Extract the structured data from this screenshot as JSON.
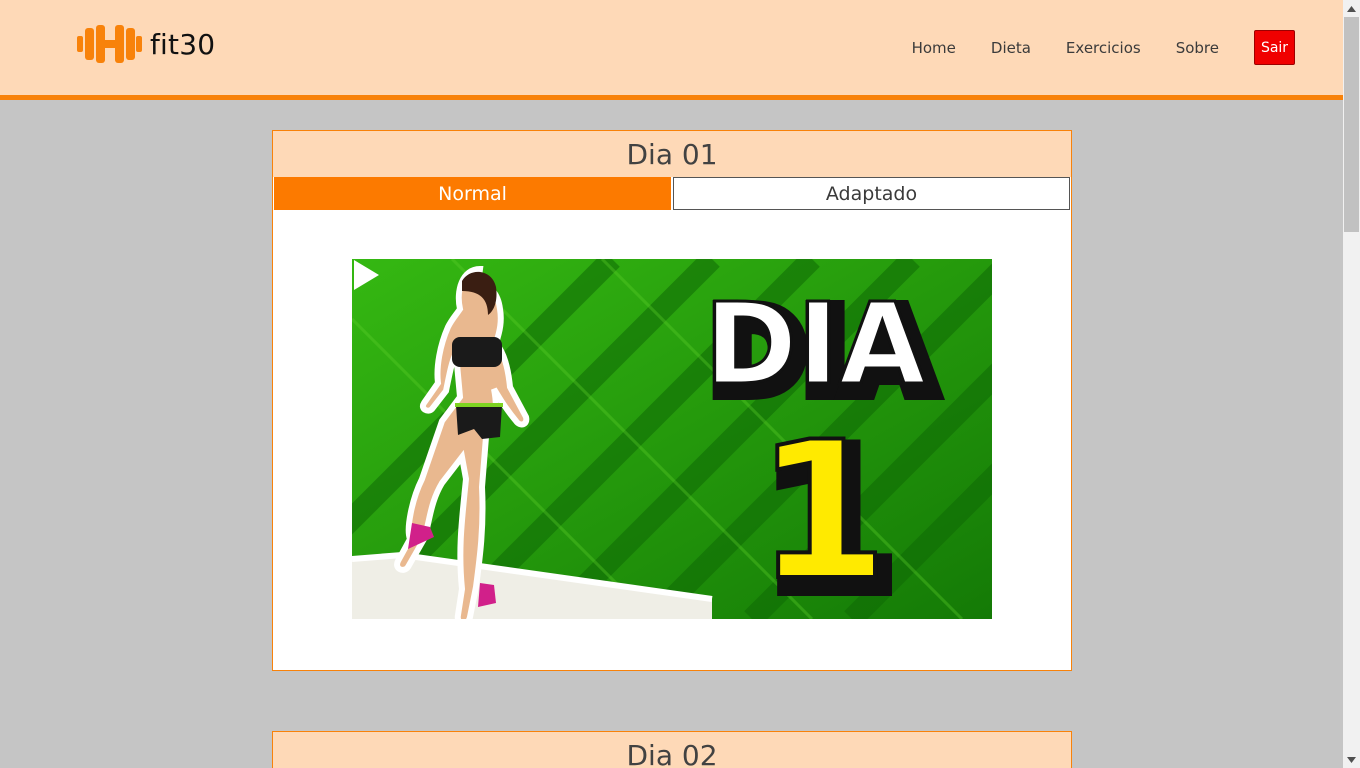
{
  "brand": {
    "name": "fit30",
    "accent": "#f8820a",
    "header_bg": "#fed9b7"
  },
  "nav": {
    "home": "Home",
    "dieta": "Dieta",
    "exercicios": "Exercicios",
    "sobre": "Sobre",
    "sair": "Sair"
  },
  "days": [
    {
      "title": "Dia 01",
      "tabs": {
        "normal": "Normal",
        "adaptado": "Adaptado"
      },
      "active_tab": "Normal",
      "video": {
        "thumbnail_text_top": "DIA",
        "thumbnail_text_number": "1",
        "icon": "play-icon"
      }
    },
    {
      "title": "Dia 02"
    }
  ]
}
